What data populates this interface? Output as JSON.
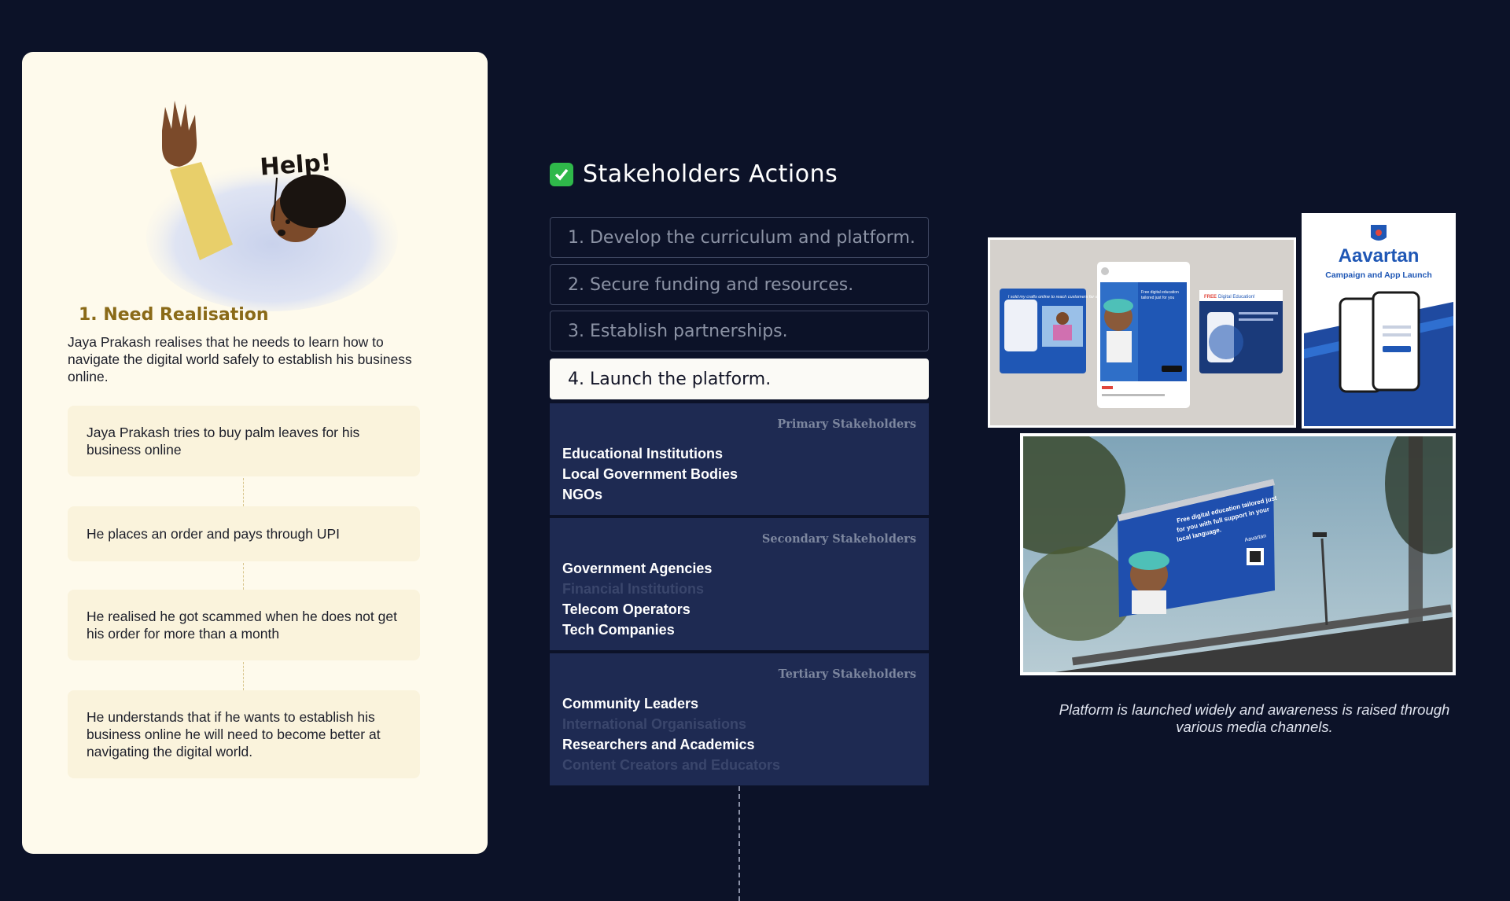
{
  "need_card": {
    "illustration_text": "Help!",
    "title": "1. Need Realisation",
    "description": "Jaya Prakash realises that he needs to learn how to navigate the digital world safely to establish his business online.",
    "steps": [
      "Jaya Prakash tries to buy palm leaves for his business online",
      "He places an order and pays through UPI",
      "He realised he got scammed when he does not get his order for more than a month",
      "He understands that if he wants to establish his business online he will need to become better at navigating the digital world."
    ]
  },
  "stakeholders": {
    "title": "Stakeholders Actions",
    "title_icon": "checkmark-icon",
    "actions": [
      "1. Develop the curriculum and platform.",
      "2. Secure funding and resources.",
      "3. Establish partnerships.",
      "4. Launch the platform."
    ],
    "active_action_index": 3,
    "groups": [
      {
        "heading": "Primary Stakeholders",
        "items": [
          {
            "name": "Educational Institutions",
            "dim": false
          },
          {
            "name": "Local Government Bodies",
            "dim": false
          },
          {
            "name": "NGOs",
            "dim": false
          }
        ]
      },
      {
        "heading": "Secondary Stakeholders",
        "items": [
          {
            "name": "Government Agencies",
            "dim": false
          },
          {
            "name": "Financial Institutions",
            "dim": true
          },
          {
            "name": "Telecom Operators",
            "dim": false
          },
          {
            "name": "Tech Companies",
            "dim": false
          }
        ]
      },
      {
        "heading": "Tertiary Stakeholders",
        "items": [
          {
            "name": "Community Leaders",
            "dim": false
          },
          {
            "name": "International Organisations",
            "dim": true
          },
          {
            "name": "Researchers and Academics",
            "dim": false
          },
          {
            "name": "Content Creators and Educators",
            "dim": true
          }
        ]
      }
    ]
  },
  "media": {
    "social_post_1": "I sold my crafts online to reach customers far and wide!",
    "social_post_2": "Free digital education tailored just for you with full support in your local language.",
    "social_post_3_tag": "FREE",
    "social_post_3": "Digital Education!",
    "social_post_3_sub": "Enhance Your Future. Access Digital Knowledge!",
    "poster_brand": "Aavartan",
    "poster_subtitle": "Campaign and App Launch",
    "billboard_headline": "Free digital education tailored just for you with full support in your local language.",
    "billboard_brand": "Aavartan",
    "caption": "Platform is launched widely and awareness is raised through various media channels."
  },
  "colors": {
    "background": "#0c1228",
    "card": "#fefaec",
    "title_gold": "#8a6a18",
    "stakeholder_panel": "#1e2a52",
    "accent_blue": "#1f57b5",
    "check_green": "#2fb84a"
  }
}
